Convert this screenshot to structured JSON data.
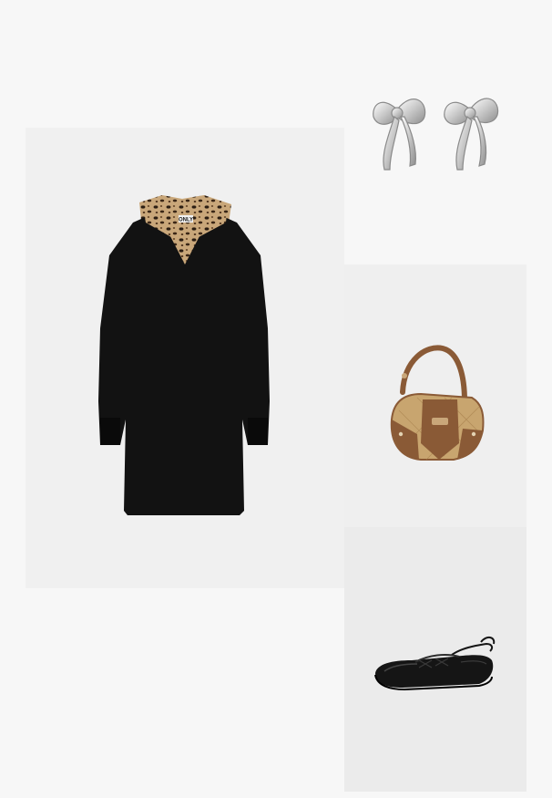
{
  "outfit": {
    "dress": {
      "brand_label": "ONLY"
    },
    "colors": {
      "page_background": "#f7f7f7",
      "dress_black": "#121212",
      "leopard_base": "#c9a77a",
      "leopard_spot": "#2b1d12",
      "silver": "#d9d9d9",
      "bag_tan": "#c8a56f",
      "bag_brown": "#8a5a36",
      "shoe_black": "#151515"
    },
    "items": [
      {
        "name": "leopard-collar-black-dress",
        "icon": "dress-icon"
      },
      {
        "name": "silver-bow-earrings",
        "icon": "earring-icon"
      },
      {
        "name": "tan-brown-shoulder-bag",
        "icon": "bag-icon"
      },
      {
        "name": "black-lace-up-ballet-flat",
        "icon": "shoe-icon"
      }
    ]
  }
}
